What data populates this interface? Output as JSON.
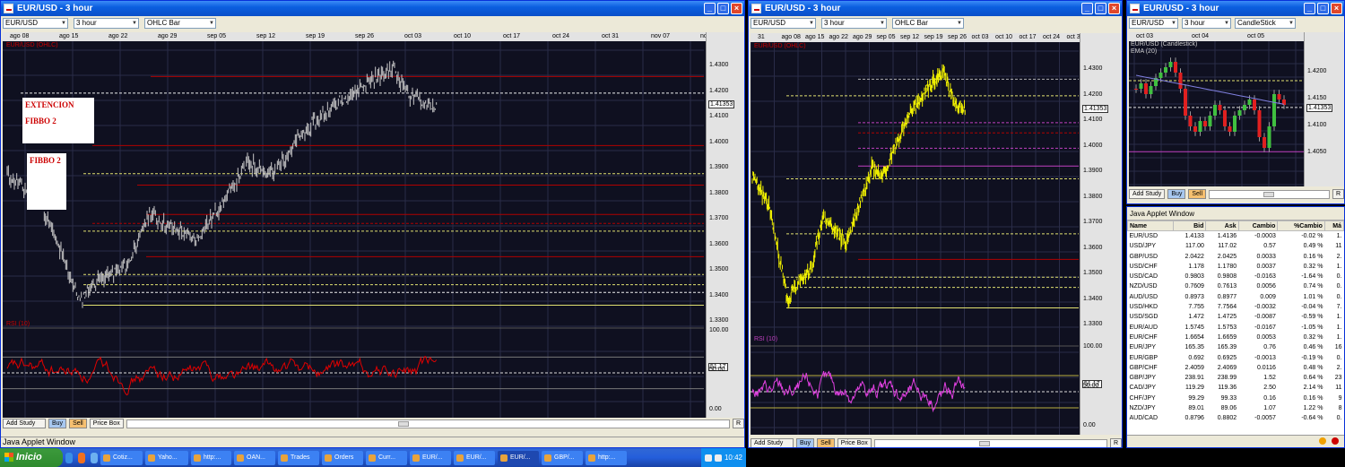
{
  "win1": {
    "title": "EUR/USD - 3 hour",
    "symbol": "EUR/USD",
    "period": "3 hour",
    "chart_type": "OHLC Bar",
    "dates": [
      "ago 08",
      "ago 15",
      "ago 22",
      "ago 29",
      "sep 05",
      "sep 12",
      "sep 19",
      "sep 26",
      "oct 03",
      "oct 10",
      "oct 17",
      "oct 24",
      "oct 31",
      "nov 07",
      "no"
    ],
    "price_legend": "EUR/USD (OHLC)",
    "price_ticks": [
      "1.4300",
      "1.4200",
      "1.4100",
      "1.4000",
      "1.3900",
      "1.3800",
      "1.3700",
      "1.3600",
      "1.3500",
      "1.3400",
      "1.3300"
    ],
    "last_price": "1.41353",
    "rsi_legend": "RSI (10)",
    "rsi_ticks": [
      "100.00",
      "50.00",
      "0.00"
    ],
    "rsi_value": "51.17",
    "box1_line1": "EXTENCION",
    "box1_line2": "FIBBO 2",
    "box2": "FIBBO 2",
    "buttons": {
      "add_study": "Add Study",
      "buy": "Buy",
      "sell": "Sell",
      "price_box": "Price Box",
      "r": "R"
    },
    "status": "Java Applet Window"
  },
  "win2": {
    "title": "EUR/USD - 3 hour",
    "symbol": "EUR/USD",
    "period": "3 hour",
    "chart_type": "OHLC Bar",
    "dates": [
      "31",
      "ago 08",
      "ago 15",
      "ago 22",
      "ago 29",
      "sep 05",
      "sep 12",
      "sep 19",
      "sep 26",
      "oct 03",
      "oct 10",
      "oct 17",
      "oct 24",
      "oct 31",
      "no"
    ],
    "price_legend": "EUR/USD (OHLC)",
    "price_ticks": [
      "1.4300",
      "1.4200",
      "1.4100",
      "1.4000",
      "1.3900",
      "1.3800",
      "1.3700",
      "1.3600",
      "1.3500",
      "1.3400",
      "1.3300"
    ],
    "last_price": "1.41353",
    "rsi_legend": "RSI (10)",
    "rsi_ticks": [
      "100.00",
      "50.00",
      "0.00"
    ],
    "rsi_value": "51.17",
    "buttons": {
      "add_study": "Add Study",
      "buy": "Buy",
      "sell": "Sell",
      "price_box": "Price Box",
      "r": "R"
    }
  },
  "win3": {
    "title": "EUR/USD - 3 hour",
    "symbol": "EUR/USD",
    "period": "3 hour",
    "chart_type": "CandleStick",
    "dates": [
      "oct 03",
      "oct 04",
      "oct 05"
    ],
    "legend1": "EUR/USD (Candlestick)",
    "legend2": "EMA (20)",
    "price_ticks": [
      "1.4200",
      "1.4150",
      "1.4100",
      "1.4050"
    ],
    "last_price": "1.41353",
    "buttons": {
      "add_study": "Add Study",
      "buy": "Buy",
      "sell": "Sell",
      "r": "R"
    }
  },
  "rates": {
    "title": "Java Applet Window",
    "columns": [
      "Name",
      "Bid",
      "Ask",
      "Cambio",
      "%Cambio",
      "Má"
    ],
    "rows": [
      [
        "EUR/USD",
        "1.4133",
        "1.4136",
        "-0.0003",
        "-0.02 %",
        "1."
      ],
      [
        "USD/JPY",
        "117.00",
        "117.02",
        "0.57",
        "0.49 %",
        "11"
      ],
      [
        "GBP/USD",
        "2.0422",
        "2.0425",
        "0.0033",
        "0.16 %",
        "2."
      ],
      [
        "USD/CHF",
        "1.178",
        "1.1780",
        "0.0037",
        "0.32 %",
        "1."
      ],
      [
        "USD/CAD",
        "0.9803",
        "0.9808",
        "-0.0163",
        "-1.64 %",
        "0."
      ],
      [
        "NZD/USD",
        "0.7609",
        "0.7613",
        "0.0056",
        "0.74 %",
        "0."
      ],
      [
        "AUD/USD",
        "0.8973",
        "0.8977",
        "0.009",
        "1.01 %",
        "0."
      ],
      [
        "USD/HKD",
        "7.755",
        "7.7564",
        "-0.0032",
        "-0.04 %",
        "7."
      ],
      [
        "USD/SGD",
        "1.472",
        "1.4725",
        "-0.0087",
        "-0.59 %",
        "1."
      ],
      [
        "EUR/AUD",
        "1.5745",
        "1.5753",
        "-0.0167",
        "-1.05 %",
        "1."
      ],
      [
        "EUR/CHF",
        "1.6654",
        "1.6659",
        "0.0053",
        "0.32 %",
        "1."
      ],
      [
        "EUR/JPY",
        "165.35",
        "165.39",
        "0.76",
        "0.46 %",
        "16"
      ],
      [
        "EUR/GBP",
        "0.692",
        "0.6925",
        "-0.0013",
        "-0.19 %",
        "0."
      ],
      [
        "GBP/CHF",
        "2.4059",
        "2.4069",
        "0.0116",
        "0.48 %",
        "2."
      ],
      [
        "GBP/JPY",
        "238.91",
        "238.99",
        "1.52",
        "0.64 %",
        "23"
      ],
      [
        "CAD/JPY",
        "119.29",
        "119.36",
        "2.50",
        "2.14 %",
        "11"
      ],
      [
        "CHF/JPY",
        "99.29",
        "99.33",
        "0.16",
        "0.16 %",
        "9"
      ],
      [
        "NZD/JPY",
        "89.01",
        "89.06",
        "1.07",
        "1.22 %",
        "8"
      ],
      [
        "AUD/CAD",
        "0.8796",
        "0.8802",
        "-0.0057",
        "-0.64 %",
        "0."
      ]
    ]
  },
  "taskbar": {
    "start": "Inicio",
    "items": [
      "Cotiz...",
      "Yaho...",
      "http:...",
      "OAN...",
      "Trades",
      "Orders",
      "Curr...",
      "EUR/...",
      "EUR/...",
      "EUR/...",
      "GBP/...",
      "http:..."
    ],
    "clock": "10:42"
  },
  "colors": {
    "ohlc_bar": "#c8c8c8",
    "ohlc_yellow": "#f0f000",
    "rsi_red": "#e00000",
    "rsi_magenta": "#e040e0",
    "fib_red": "#b00000",
    "fib_yellow": "#e0e070"
  }
}
